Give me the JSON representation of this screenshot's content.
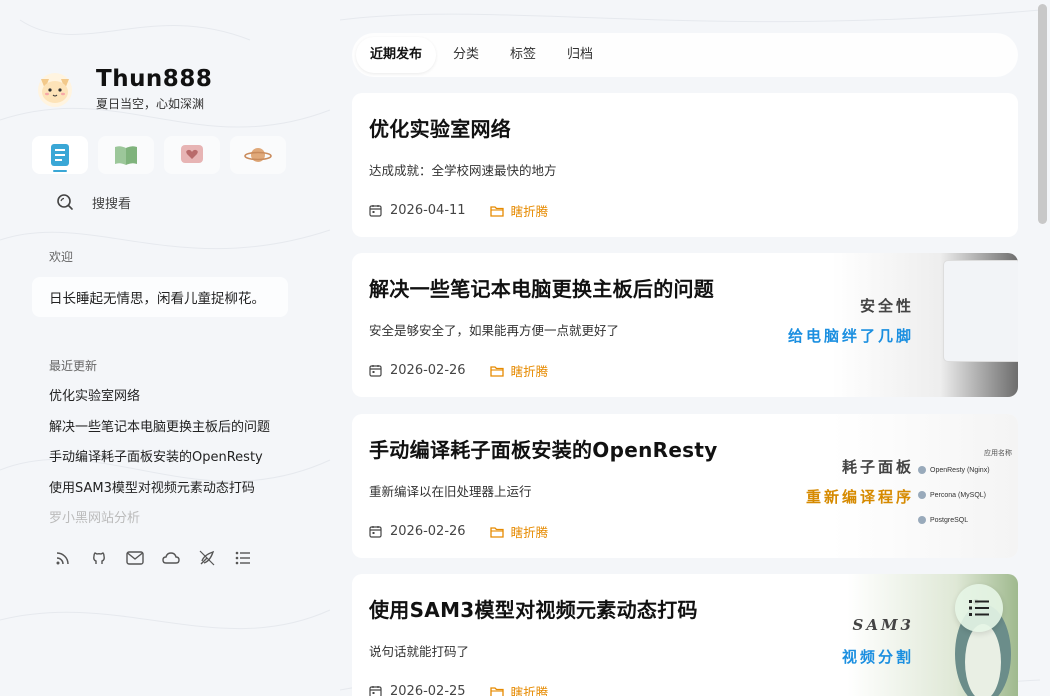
{
  "site": {
    "title": "Thun888",
    "subtitle": "夏日当空，心如深渊"
  },
  "nav_icons": [
    "document-icon",
    "book-icon",
    "heart-icon",
    "planet-icon"
  ],
  "search": {
    "label": "搜搜看"
  },
  "welcome": {
    "heading": "欢迎",
    "text": "日长睡起无情思，闲看儿童捉柳花。"
  },
  "recent": {
    "heading": "最近更新",
    "items": [
      "优化实验室网络",
      "解决一些笔记本电脑更换主板后的问题",
      "手动编译耗子面板安装的OpenResty",
      "使用SAM3模型对视频元素动态打码",
      "罗小黑网站分析"
    ]
  },
  "social_icons": [
    "rss-icon",
    "github-icon",
    "mail-icon",
    "cloud-icon",
    "rocket-icon",
    "list-icon"
  ],
  "tabs": [
    "近期发布",
    "分类",
    "标签",
    "归档"
  ],
  "posts": [
    {
      "title": "优化实验室网络",
      "desc": "达成成就：全学校网速最快的地方",
      "date": "2026-04-11",
      "category": "瞎折腾"
    },
    {
      "title": "解决一些笔记本电脑更换主板后的问题",
      "desc": "安全是够安全了，如果能再方便一点就更好了",
      "date": "2026-02-26",
      "category": "瞎折腾",
      "cover": {
        "line1": "安全性",
        "line2": "给电脑绊了几脚"
      }
    },
    {
      "title": "手动编译耗子面板安装的OpenResty",
      "desc": "重新编译以在旧处理器上运行",
      "date": "2026-02-26",
      "category": "瞎折腾",
      "cover": {
        "line1": "耗子面板",
        "line2": "重新编译程序",
        "list_header": "应用名称",
        "list": [
          "OpenResty (Nginx)",
          "Percona (MySQL)",
          "PostgreSQL"
        ]
      }
    },
    {
      "title": "使用SAM3模型对视频元素动态打码",
      "desc": "说句话就能打码了",
      "date": "2026-02-25",
      "category": "瞎折腾",
      "cover": {
        "line1": "SAM3",
        "line2": "视频分割"
      }
    }
  ],
  "colors": {
    "accent": "#3aa7d6",
    "category": "#e68a00",
    "cover_blue": "#1b8fe0"
  }
}
